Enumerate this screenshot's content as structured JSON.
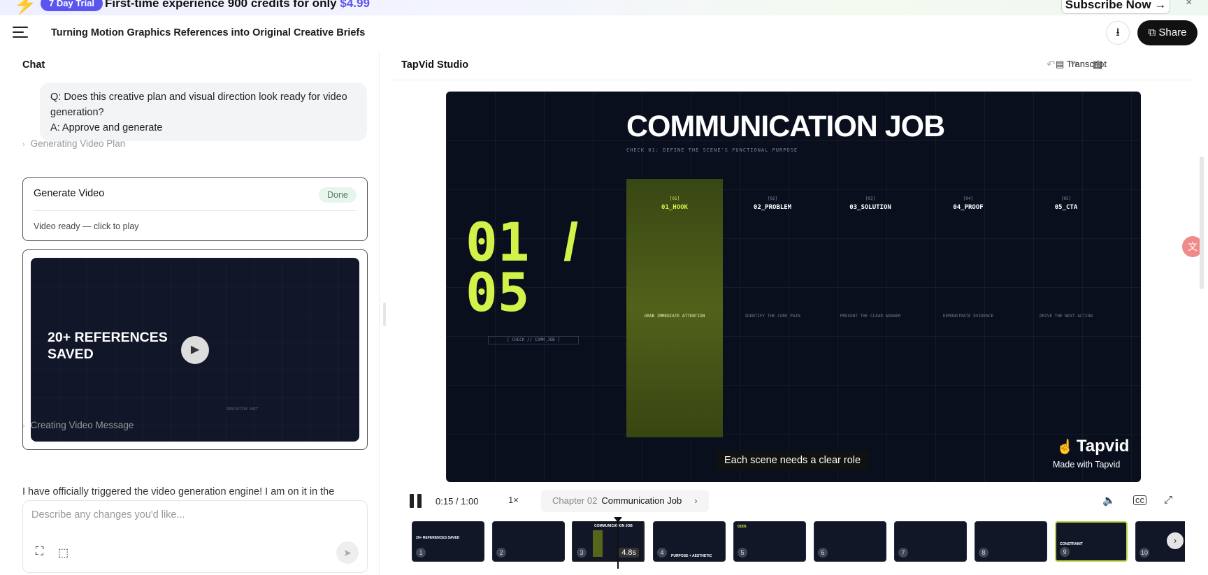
{
  "banner": {
    "trial_label": "7 Day Trial",
    "text": "First-time experience 900 credits for only",
    "price": "$4.99",
    "subscribe_label": "Subscribe Now →",
    "close_icon": "×"
  },
  "header": {
    "title": "Turning Motion Graphics References into Original Creative Briefs",
    "share_label": "Share"
  },
  "chat": {
    "title": "Chat",
    "bubble_q": "Q: Does this creative plan and visual direction look ready for video generation?",
    "bubble_a": "A: Approve and generate",
    "step_plan": "Generating Video Plan",
    "gen_title": "Generate Video",
    "gen_status": "Done",
    "gen_sub": "Video ready — click to play",
    "video_text": "20+ REFERENCES SAVED",
    "video_small": "DERIVATIVE SHIT",
    "step_message": "Creating Video Message",
    "message": "I have officially triggered the video generation engine! I am on it in the",
    "input_placeholder": "Describe any changes you'd like..."
  },
  "studio": {
    "title": "TapVid Studio",
    "transcript_label": "Transcript"
  },
  "stage": {
    "title": "COMMUNICATION JOB",
    "subtitle": "CHECK 01: DEFINE THE SCENE'S FUNCTIONAL PURPOSE",
    "big_num": "01",
    "big_slash": "/",
    "big_den": "05",
    "check": "[ CHECK // COMM_JOB ]",
    "columns": [
      {
        "n": "[01]",
        "label": "01_HOOK",
        "desc": "GRAB IMMEDIATE ATTENTION"
      },
      {
        "n": "[02]",
        "label": "02_PROBLEM",
        "desc": "IDENTIFY THE CORE PAIN"
      },
      {
        "n": "[03]",
        "label": "03_SOLUTION",
        "desc": "PRESENT THE CLEAR ANSWER"
      },
      {
        "n": "[04]",
        "label": "04_PROOF",
        "desc": "DEMONSTRATE EVIDENCE"
      },
      {
        "n": "[05]",
        "label": "05_CTA",
        "desc": "DRIVE THE NEXT ACTION"
      }
    ],
    "logo": "Tapvid",
    "made_with": "Made with Tapvid",
    "caption": "Each scene needs a clear role"
  },
  "player": {
    "time": "0:15 / 1:00",
    "speed": "1×",
    "chapter_num": "Chapter 02",
    "chapter_title": "Communication Job",
    "chapter_arrow": "›"
  },
  "thumbnails": [
    {
      "num": "1",
      "text": "20+ REFERENCES SAVED"
    },
    {
      "num": "2",
      "text": ""
    },
    {
      "num": "3",
      "text": "COMMUNICATION JOB",
      "dur": "4.8s"
    },
    {
      "num": "4",
      "text": "PURPOSE + AESTHETIC"
    },
    {
      "num": "5",
      "text": "02/05"
    },
    {
      "num": "6",
      "text": ""
    },
    {
      "num": "7",
      "text": ""
    },
    {
      "num": "8",
      "text": ""
    },
    {
      "num": "9",
      "text": "CONSTRAINT"
    },
    {
      "num": "10",
      "text": ""
    }
  ],
  "colors": {
    "accent": "#5b55f0",
    "lime": "#d2f24a",
    "dark": "#0a0f1e"
  },
  "icons": {
    "menu": "menu-icon",
    "download": "download-icon",
    "share": "share-icon",
    "undo": "undo-icon",
    "redo": "redo-icon",
    "doc": "document-icon",
    "play": "play-icon",
    "pause": "pause-icon",
    "volume": "volume-icon",
    "captions": "captions-icon",
    "fullscreen": "fullscreen-icon"
  }
}
